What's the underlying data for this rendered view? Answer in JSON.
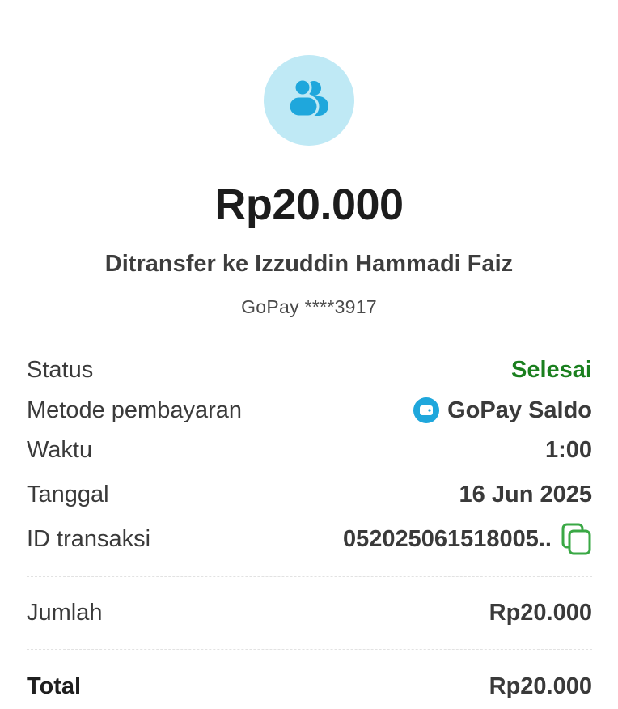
{
  "header": {
    "avatar_icon": "users-icon",
    "amount": "Rp20.000",
    "recipient": "Ditransfer ke Izzuddin Hammadi Faiz",
    "account": "GoPay ****3917"
  },
  "details": [
    {
      "label": "Status",
      "value": "Selesai"
    },
    {
      "label": "Metode pembayaran",
      "value": "GoPay Saldo",
      "icon": "wallet-icon"
    },
    {
      "label": "Waktu",
      "value": "1:00"
    },
    {
      "label": "Tanggal",
      "value": "16 Jun 2025"
    },
    {
      "label": "ID transaksi",
      "value": "052025061518005..",
      "action_icon": "copy-icon"
    }
  ],
  "summary": {
    "jumlah_label": "Jumlah",
    "jumlah_value": "Rp20.000",
    "total_label": "Total",
    "total_value": "Rp20.000"
  },
  "colors": {
    "status": "#1a7f1e",
    "avatar_bg": "#bfe9f5",
    "brand_blue": "#1fa7dc",
    "copy_green": "#3aa845"
  }
}
